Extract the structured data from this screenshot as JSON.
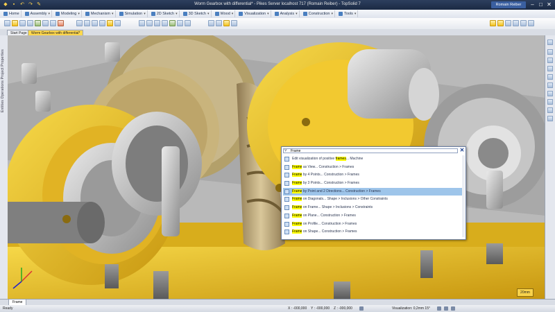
{
  "window": {
    "title": "Worm Gearbox with differential* - Pikes Server localhost 717 (Romain Reiber) - TopSolid 7",
    "user": "Romain Reiber"
  },
  "menu": [
    {
      "label": "Home"
    },
    {
      "label": "Assembly"
    },
    {
      "label": "Modeling"
    },
    {
      "label": "Mechanism"
    },
    {
      "label": "Simulation"
    },
    {
      "label": "2D Sketch"
    },
    {
      "label": "3D Sketch"
    },
    {
      "label": "Wood"
    },
    {
      "label": "Visualization"
    },
    {
      "label": "Analysis"
    },
    {
      "label": "Construction"
    },
    {
      "label": "Tools"
    }
  ],
  "tabs": {
    "start": "Start Page",
    "document": "Worm Gearbox with differential*"
  },
  "leftstrip": {
    "label": "Entities  Operations  Project  Properties"
  },
  "search": {
    "query": "Frame"
  },
  "results": [
    {
      "pre": "Edit visualization of positive ",
      "hl": "frames",
      "post": "...   Machine"
    },
    {
      "pre": "",
      "hl": "Frame",
      "post": " as View...   Construction > Frames"
    },
    {
      "pre": "",
      "hl": "Frame",
      "post": " by 4 Points...   Construction > Frames"
    },
    {
      "pre": "",
      "hl": "Frame",
      "post": " by 3 Points...   Construction > Frames"
    },
    {
      "pre": "",
      "hl": "Frame",
      "post": " by Point and 2 Directions...   Construction > Frames"
    },
    {
      "pre": "",
      "hl": "Frame",
      "post": " on Diagonals...   Shape > Inclusions > Other Constraints"
    },
    {
      "pre": "",
      "hl": "Frame",
      "post": " on Frame...   Shape > Inclusions > Constraints"
    },
    {
      "pre": "",
      "hl": "Frame",
      "post": " on Plane...   Construction > Frames"
    },
    {
      "pre": "",
      "hl": "Frame",
      "post": " on Profile...   Construction > Frames"
    },
    {
      "pre": "",
      "hl": "Frame",
      "post": " on Shape...   Construction > Frames"
    }
  ],
  "scale": {
    "label": "20mm"
  },
  "bottom": {
    "tab": "Frame",
    "status": "Ready",
    "x": "X : -000,000",
    "y": "Y : -000,000",
    "z": "Z : -000,000",
    "visualization": "Visualization: 0,2mm 15°"
  }
}
